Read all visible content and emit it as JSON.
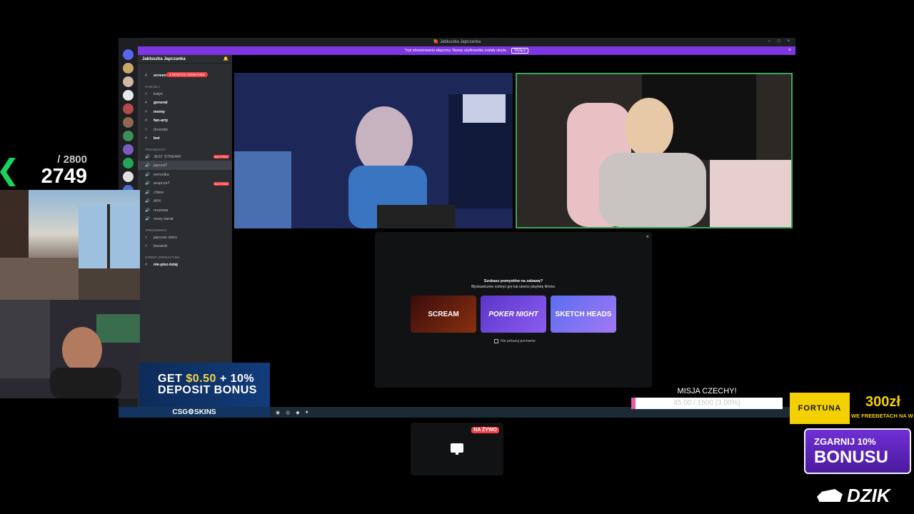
{
  "discord": {
    "window_title": "🍓 Jabluszka Japczanka",
    "notice_text": "Tryb streamowania włączony. Nazwy użytkownika zostały ukryte.",
    "notice_button": "Wyłącz",
    "server_name": "Jabluszka Japczanka",
    "new_mentions": "3 NOWYCH WZMIANEK",
    "channels": [
      {
        "type": "text",
        "name": "screenshoty",
        "bold": true
      },
      {
        "type": "category",
        "name": "KANCZKA"
      },
      {
        "type": "text",
        "name": "katyn",
        "bold": false
      },
      {
        "type": "text",
        "name": "general",
        "bold": true
      },
      {
        "type": "text",
        "name": "memy",
        "bold": true
      },
      {
        "type": "text",
        "name": "fan-arty",
        "bold": true
      },
      {
        "type": "text",
        "name": "drzewko",
        "bold": false
      },
      {
        "type": "text",
        "name": "bot",
        "bold": true
      },
      {
        "type": "category",
        "name": "POGADUCHY"
      },
      {
        "type": "voice",
        "name": "JEST STREAM",
        "live": "NA ŻYWO"
      },
      {
        "type": "voice",
        "name": "japczaT",
        "active": true
      },
      {
        "type": "voice",
        "name": "wersolka"
      },
      {
        "type": "voice",
        "name": "arapczaT",
        "live": "NA ŻYWO"
      },
      {
        "type": "voice",
        "name": "chlew"
      },
      {
        "type": "voice",
        "name": "AFK"
      },
      {
        "type": "voice",
        "name": "muzwaa"
      },
      {
        "type": "voice",
        "name": "nowy kanał"
      },
      {
        "type": "category",
        "name": "TARGOWISKO"
      },
      {
        "type": "text",
        "name": "japczan skins"
      },
      {
        "type": "text",
        "name": "bazarek"
      },
      {
        "type": "category",
        "name": "STREFA OPERACYJNA"
      },
      {
        "type": "text",
        "name": "nie-pisz-tutaj",
        "bold": true
      }
    ],
    "activity": {
      "title": "Szukasz pomysłów na zabawę?",
      "subtitle": "Błyskawicznie rozkręć grę lub utwórz playlistę filmów.",
      "games": [
        "SCREAM",
        "POKER NIGHT",
        "SKETCH HEADS"
      ],
      "checkbox_label": "Nie pokazuj ponownie"
    }
  },
  "counter": {
    "goal": "/ 2800",
    "value": "2749"
  },
  "ad_deposit": {
    "line1_pre": "GET ",
    "amount": "$0.50",
    "line1_post": " + 10%",
    "line2": "DEPOSIT BONUS",
    "brand": "CSG⚙SKINS"
  },
  "preview": {
    "live_badge": "NA ŻYWO"
  },
  "mission": {
    "title": "MISJA CZECHY!",
    "progress_text": "45.00 / 1500 (3.00%)",
    "progress_fraction": 0.03
  },
  "fortuna": {
    "brand": "FORTUNA",
    "amount": "300zł",
    "sub": "WE FREEBETACH NA W"
  },
  "dzik": {
    "line1": "ZGARNIJ 10%",
    "line2": "BONUSU",
    "logo": "DZIK"
  },
  "colors": {
    "accent": "#7e36e0",
    "live": "#f23f43",
    "online": "#3ba55c",
    "mission_fill": "#e75aa6"
  }
}
